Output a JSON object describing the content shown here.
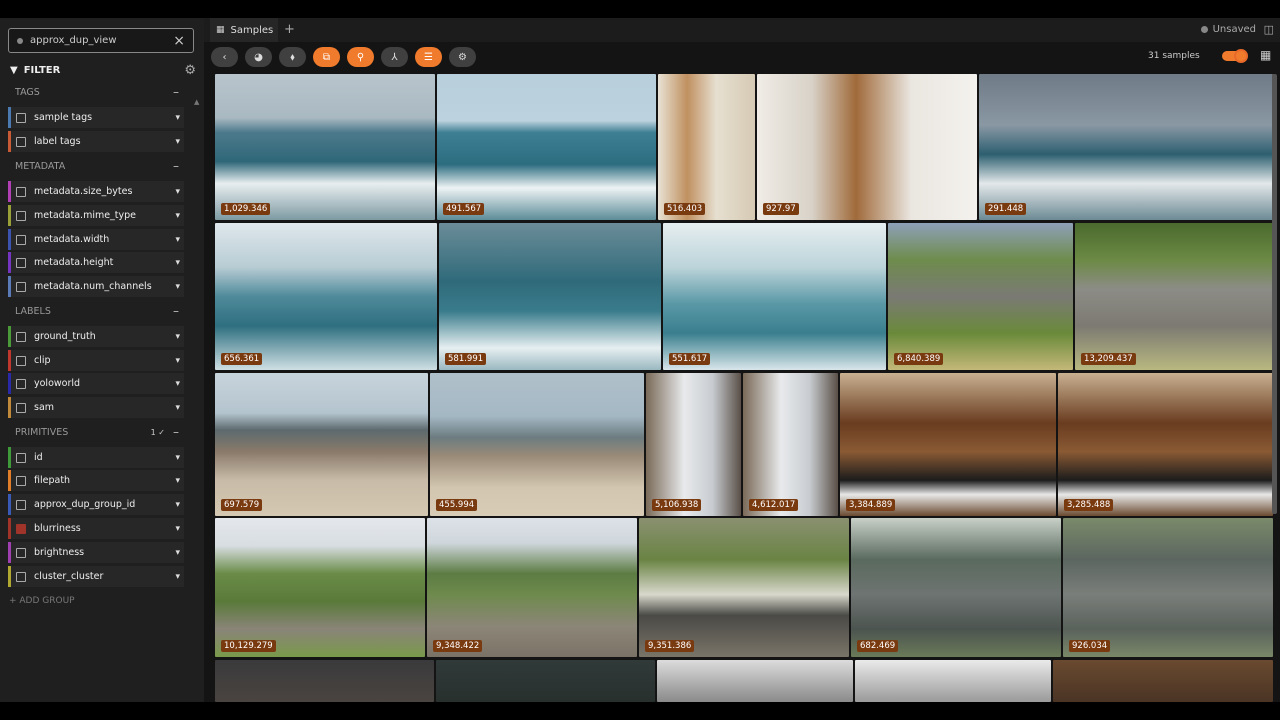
{
  "view": {
    "name": "approx_dup_view"
  },
  "filter": {
    "title": "FILTER",
    "add_group": "+ ADD GROUP"
  },
  "groups": {
    "tags": "TAGS",
    "metadata": "METADATA",
    "labels": "LABELS",
    "primitives": "PRIMITIVES",
    "primitives_badge": "1 ✓"
  },
  "fields": {
    "sample_tags": "sample tags",
    "label_tags": "label tags",
    "size_bytes": "metadata.size_bytes",
    "mime_type": "metadata.mime_type",
    "width": "metadata.width",
    "height": "metadata.height",
    "num_channels": "metadata.num_channels",
    "ground_truth": "ground_truth",
    "clip": "clip",
    "yoloworld": "yoloworld",
    "sam": "sam",
    "id": "id",
    "filepath": "filepath",
    "group_id": "approx_dup_group_id",
    "blurriness": "blurriness",
    "brightness": "brightness",
    "cluster": "cluster_cluster"
  },
  "tabs": {
    "samples": "Samples"
  },
  "status": {
    "unsaved": "Unsaved",
    "count": "31 samples"
  },
  "colors": {
    "accent": "#f07b2c",
    "sidebar": "#1f1f1f",
    "label_bg": "#7a3a10"
  },
  "tiles": {
    "t1": "1,029.346",
    "t2": "491.567",
    "t3": "516.403",
    "t4": "927.97",
    "t5": "291.448",
    "t6": "656.361",
    "t7": "581.991",
    "t8": "551.617",
    "t9": "6,840.389",
    "t10": "13,209.437",
    "t11": "697.579",
    "t12": "455.994",
    "t13": "5,106.938",
    "t14": "4,612.017",
    "t15": "3,384.889",
    "t16": "3,285.488",
    "t17": "10,129.279",
    "t18": "9,348.422",
    "t19": "9,351.386",
    "t20": "682.469",
    "t21": "926.034"
  }
}
